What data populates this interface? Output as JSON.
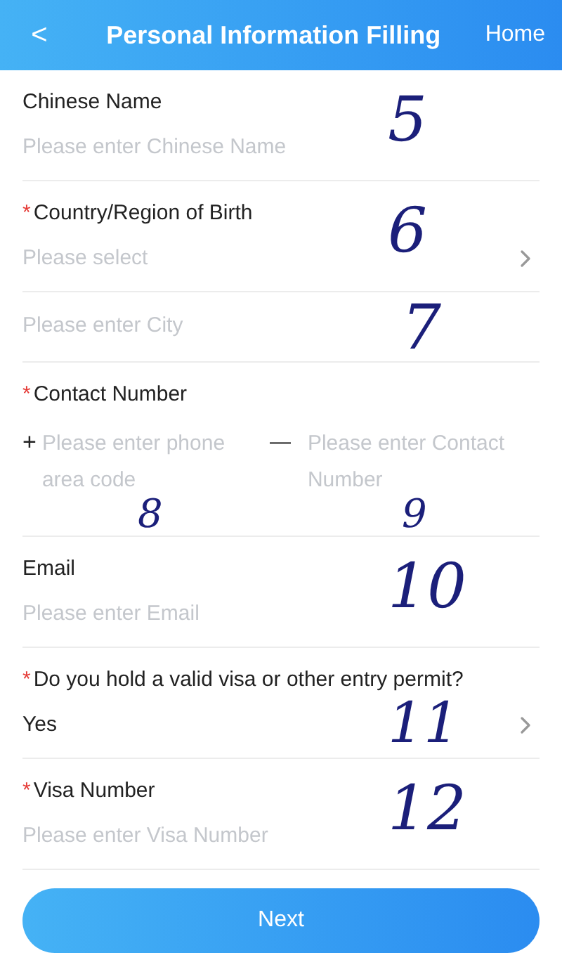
{
  "header": {
    "back": "<",
    "title": "Personal Information Filling",
    "home": "Home"
  },
  "sections": [
    {
      "kind": "text",
      "label": "Chinese Name",
      "placeholder": "Please enter Chinese Name",
      "annotation": "5"
    },
    {
      "kind": "select",
      "label": "Country/Region of Birth",
      "required_mark": "*",
      "placeholder": "Please select",
      "annotation": "6"
    },
    {
      "kind": "plain",
      "placeholder": "Please enter City",
      "annotation": "7"
    },
    {
      "kind": "phone",
      "label": "Contact Number",
      "required_mark": "*",
      "prefix": "+",
      "separator": "—",
      "placeholder": "Please enter phone area code",
      "placeholder_2": "Please enter Contact Number",
      "annotation": "8",
      "annotation_2": "9"
    },
    {
      "kind": "text",
      "label": "Email",
      "placeholder": "Please enter Email",
      "annotation": "10"
    },
    {
      "kind": "select",
      "label": "Do you hold a valid visa or other entry permit?",
      "required_mark": "*",
      "value": "Yes",
      "annotation": "11"
    },
    {
      "kind": "text",
      "label": "Visa Number",
      "required_mark": "*",
      "placeholder": "Please enter Visa Number",
      "annotation": "12"
    }
  ],
  "next_button": "Next"
}
